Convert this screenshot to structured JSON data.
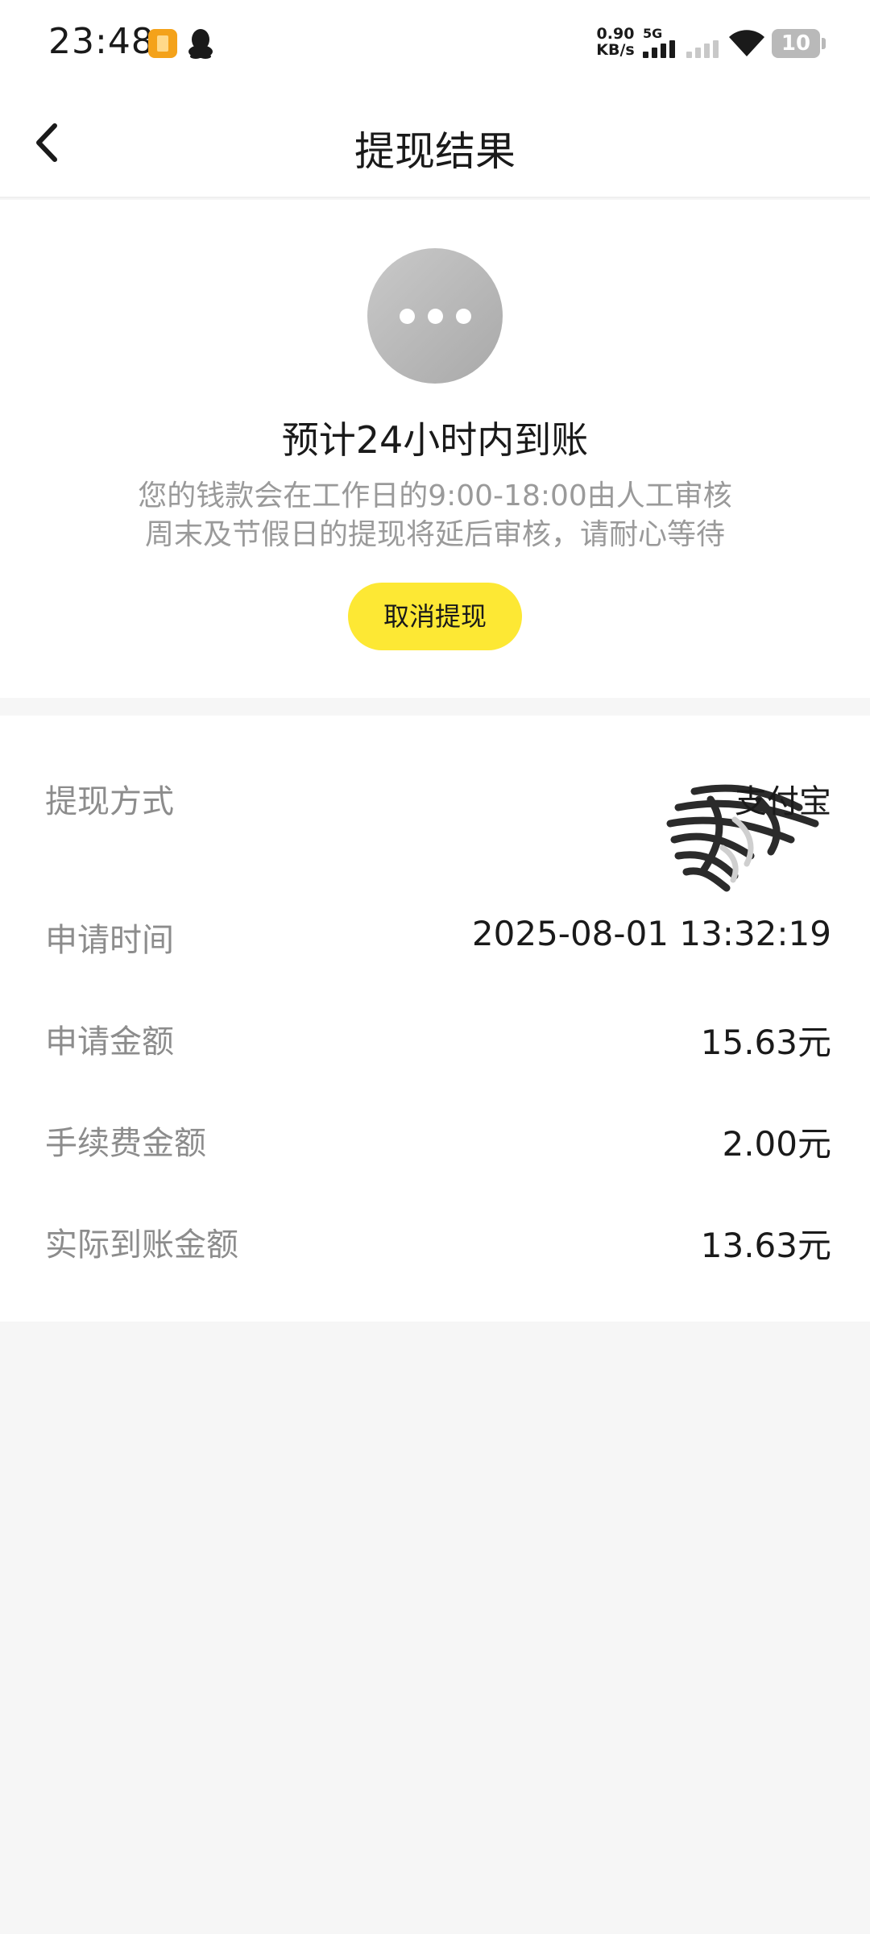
{
  "status_bar": {
    "time": "23:48",
    "net_speed_value": "0.90",
    "net_speed_unit": "KB/s",
    "network_type": "5G",
    "battery_level": "10",
    "icons": [
      "app-notification-icon",
      "qq-icon",
      "signal-icon",
      "signal-icon",
      "wifi-icon",
      "battery-icon"
    ]
  },
  "header": {
    "title": "提现结果",
    "back_icon": "chevron-left-icon"
  },
  "result": {
    "status_icon": "more-dots-icon",
    "title": "预计24小时内到账",
    "desc_line1": "您的钱款会在工作日的9:00-18:00由人工审核",
    "desc_line2": "周末及节假日的提现将延后审核，请耐心等待",
    "cancel_label": "取消提现",
    "colors": {
      "button": "#fde834",
      "icon": "#b7b7b7"
    }
  },
  "details": {
    "rows": [
      {
        "label": "提现方式",
        "value": "支付宝"
      },
      {
        "label": "申请时间",
        "value": "2025-08-01 13:32:19"
      },
      {
        "label": "申请金额",
        "value": "15.63元"
      },
      {
        "label": "手续费金额",
        "value": "2.00元"
      },
      {
        "label": "实际到账金额",
        "value": "13.63元"
      }
    ]
  }
}
